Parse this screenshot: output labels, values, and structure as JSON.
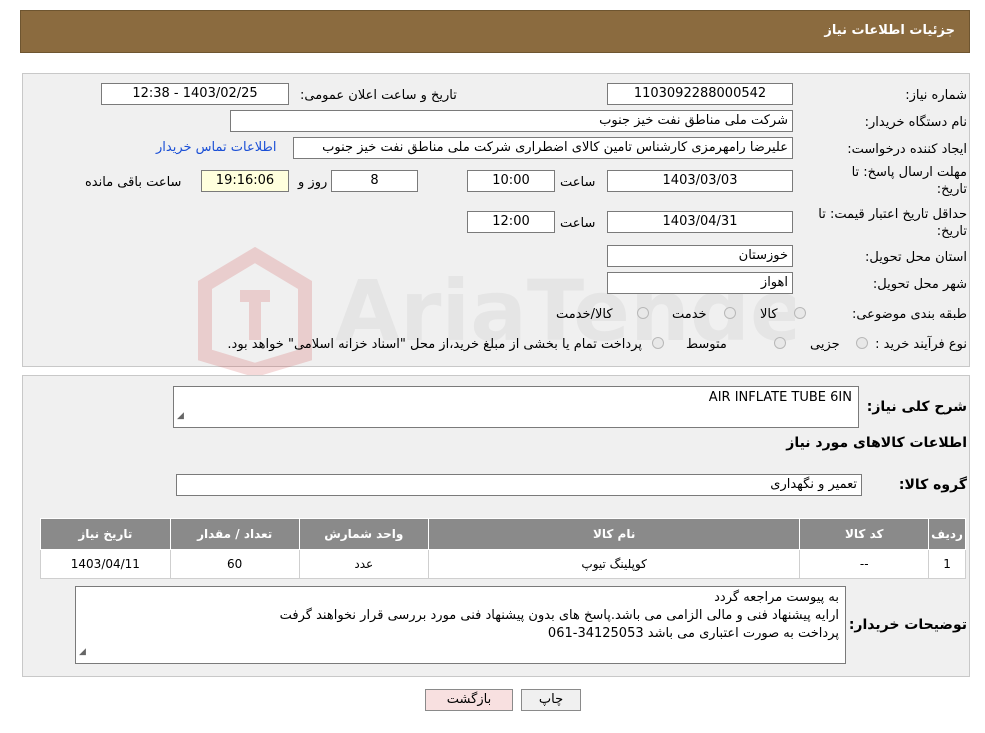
{
  "header": {
    "title": "جزئیات اطلاعات نیاز"
  },
  "form": {
    "need_number_label": "شماره نیاز:",
    "need_number": "1103092288000542",
    "announce_label": "تاریخ و ساعت اعلان عمومی:",
    "announce_value": "1403/02/25 - 12:38",
    "buyer_label": "نام دستگاه خریدار:",
    "buyer_value": "شرکت ملی مناطق نفت خیز جنوب",
    "creator_label": "ایجاد کننده درخواست:",
    "creator_value": "علیرضا رامهرمزی کارشناس تامین کالای اضطراری شرکت ملی مناطق نفت خیز جنوب",
    "contact_link": "اطلاعات تماس خریدار",
    "deadline_label_1": "مهلت ارسال پاسخ: تا",
    "deadline_label_2": "تاریخ:",
    "deadline_date": "1403/03/03",
    "time_label": "ساعت",
    "deadline_time": "10:00",
    "days_value": "8",
    "days_label": "روز و",
    "remaining_time": "19:16:06",
    "remaining_label": "ساعت باقی مانده",
    "validity_label_1": "حداقل تاریخ اعتبار قیمت: تا",
    "validity_label_2": "تاریخ:",
    "validity_date": "1403/04/31",
    "validity_time": "12:00",
    "province_label": "استان محل تحویل:",
    "province_value": "خوزستان",
    "city_label": "شهر محل تحویل:",
    "city_value": "اهواز",
    "category_label": "طبقه بندی موضوعی:",
    "category_options": [
      "کالا",
      "خدمت",
      "کالا/خدمت"
    ],
    "process_label": "نوع فرآیند خرید :",
    "process_options": [
      "جزیی",
      "متوسط"
    ],
    "process_note": "پرداخت تمام یا بخشی از مبلغ خرید،از محل \"اسناد خزانه اسلامی\" خواهد بود."
  },
  "details": {
    "summary_label": "شرح کلی نیاز:",
    "summary_value": "AIR INFLATE TUBE 6IN",
    "items_title": "اطلاعات کالاهای مورد نیاز",
    "group_label": "گروه کالا:",
    "group_value": "تعمیر و نگهداری",
    "table": {
      "headers": [
        "ردیف",
        "کد کالا",
        "نام کالا",
        "واحد شمارش",
        "تعداد / مقدار",
        "تاریخ نیاز"
      ],
      "rows": [
        [
          "1",
          "--",
          "کوپلینگ تیوپ",
          "عدد",
          "60",
          "1403/04/11"
        ]
      ]
    },
    "notes_label": "توضیحات خریدار:",
    "notes_lines": [
      "به پیوست مراجعه گردد",
      "ارایه پیشنهاد فنی و مالی الزامی می باشد.پاسخ های بدون پیشنهاد فنی مورد بررسی قرار نخواهند گرفت",
      "پرداخت به صورت اعتباری می باشد 34125053-061"
    ]
  },
  "buttons": {
    "print": "چاپ",
    "back": "بازگشت"
  },
  "watermark_text": "AriaTender.neT",
  "colors": {
    "header": "#8b6b3f",
    "link": "#1a4fd6",
    "table_header": "#8a8a8a",
    "back_button": "#f8e0e0"
  }
}
